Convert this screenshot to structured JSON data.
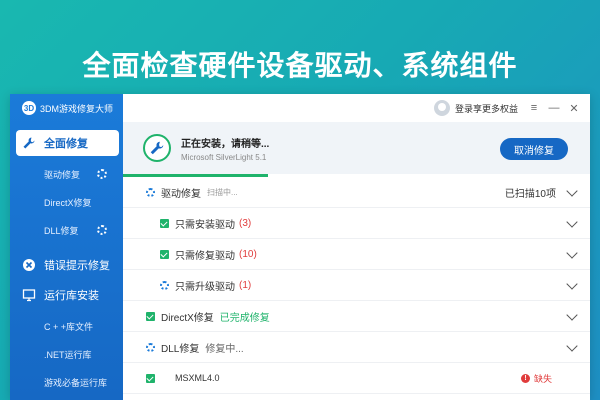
{
  "banner": {
    "title": "全面检查硬件设备驱动、系统组件"
  },
  "app": {
    "logo_text": "3D",
    "title": "3DM游戏修复大师"
  },
  "sidebar": {
    "items": [
      {
        "label": "全面修复",
        "icon": "wrench-icon",
        "active": true
      },
      {
        "label": "驱动修复",
        "sub": true,
        "spinner": true
      },
      {
        "label": "DirectX修复",
        "sub": true
      },
      {
        "label": "DLL修复",
        "sub": true,
        "spinner": true
      },
      {
        "label": "错误提示修复",
        "icon": "x-circle-icon"
      },
      {
        "label": "运行库安装",
        "icon": "monitor-icon"
      },
      {
        "label": "C + +库文件",
        "sub": true
      },
      {
        "label": ".NET运行库",
        "sub": true
      },
      {
        "label": "游戏必备运行库",
        "sub": true
      }
    ]
  },
  "topbar": {
    "login_label": "登录享更多权益",
    "menu": "≡",
    "minimize": "—",
    "close": "✕"
  },
  "status": {
    "title": "正在安装，请稍等...",
    "subtitle": "Microsoft SilverLight 5.1",
    "cancel_label": "取消修复",
    "progress": 0.31
  },
  "list": {
    "driver": {
      "label": "驱动修复",
      "state": "扫描中...",
      "right": "已扫描10项"
    },
    "install_driver": {
      "label": "只需安装驱动",
      "count": "(3)"
    },
    "repair_driver": {
      "label": "只需修复驱动",
      "count": "(10)"
    },
    "upgrade_driver": {
      "label": "只需升级驱动",
      "count": "(1)"
    },
    "directx": {
      "label": "DirectX修复",
      "state": "已完成修复"
    },
    "dll": {
      "label": "DLL修复",
      "state": "修复中..."
    },
    "msxml": {
      "label": "MSXML4.0",
      "fail_icon": "!",
      "fail_label": "缺失"
    }
  },
  "colors": {
    "accent": "#1668c4",
    "success": "#1fb36b",
    "danger": "#e03c3c"
  }
}
